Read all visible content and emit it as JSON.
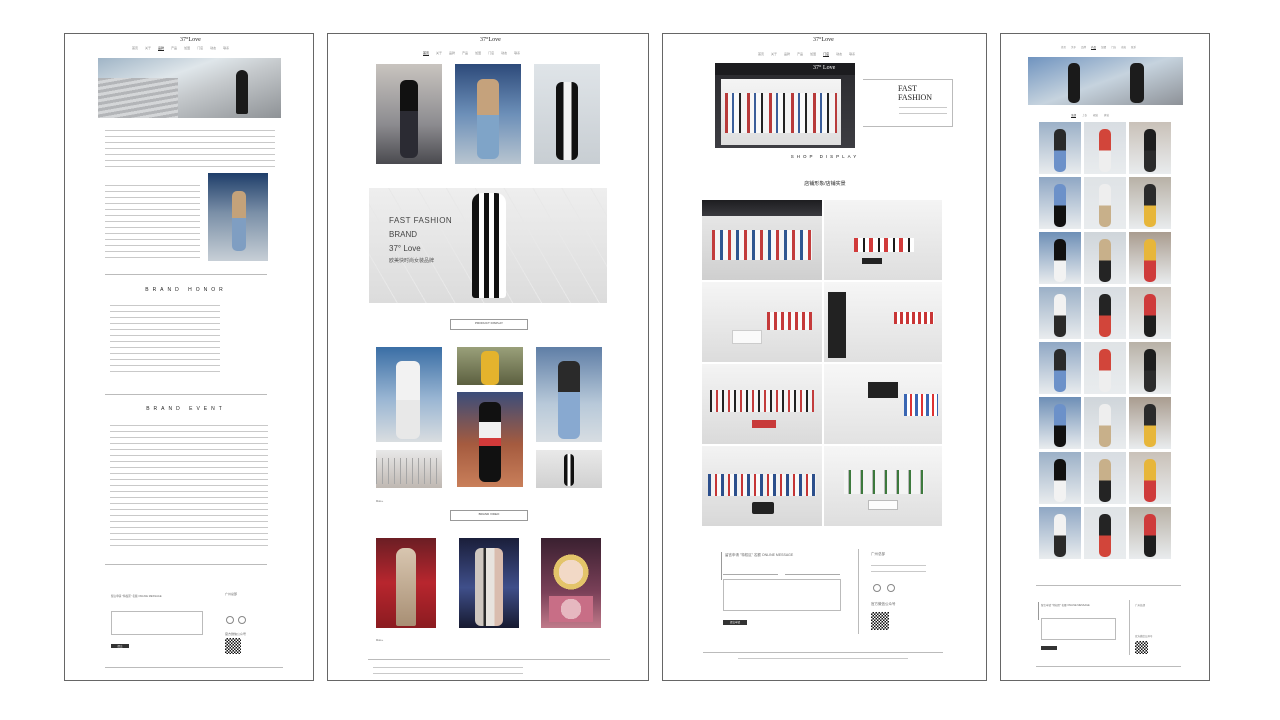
{
  "brand": {
    "logo": "37°Love",
    "logo_p3": "37° Love"
  },
  "p1": {
    "section_honor": "BRAND HONOR",
    "section_event": "BRAND EVENT",
    "online_msg_label": "留言申请 \"特权区\" 名额 ONLINE MESSAGE",
    "guangzhou": "广州总部",
    "qr_label": "官方微信公众号",
    "submit": "提交"
  },
  "p2": {
    "hero_line1": "FAST FASHION",
    "hero_line2": "BRAND",
    "hero_line3": "37° Love",
    "hero_line4": "欧美快时尚女装品牌",
    "btn1_en": "PRODUCT DISPLAY",
    "btn1_cn": "品牌图片",
    "btn2_en": "BRAND VIDEO",
    "btn2_cn": "品牌视频"
  },
  "p3": {
    "fast": "FAST",
    "fashion": "FASHION",
    "shop_display": "SHOP DISPLAY",
    "store_title": "店铺形象/店铺实景",
    "msg_title": "留言申请 \"特权区\" 名额 ONLINE MESSAGE",
    "guangzhou": "广州总部",
    "qr_label": "官方微信公众号",
    "submit": "提交申请"
  },
  "p4": {
    "msg_title": "留言申请 \"特权区\" 名额 ONLINE MESSAGE",
    "guangzhou": "广州总部",
    "qr_label": "官方微信公众号"
  },
  "colors": {
    "accent": "#111111",
    "border": "#666666",
    "line": "#bbbbbb"
  }
}
